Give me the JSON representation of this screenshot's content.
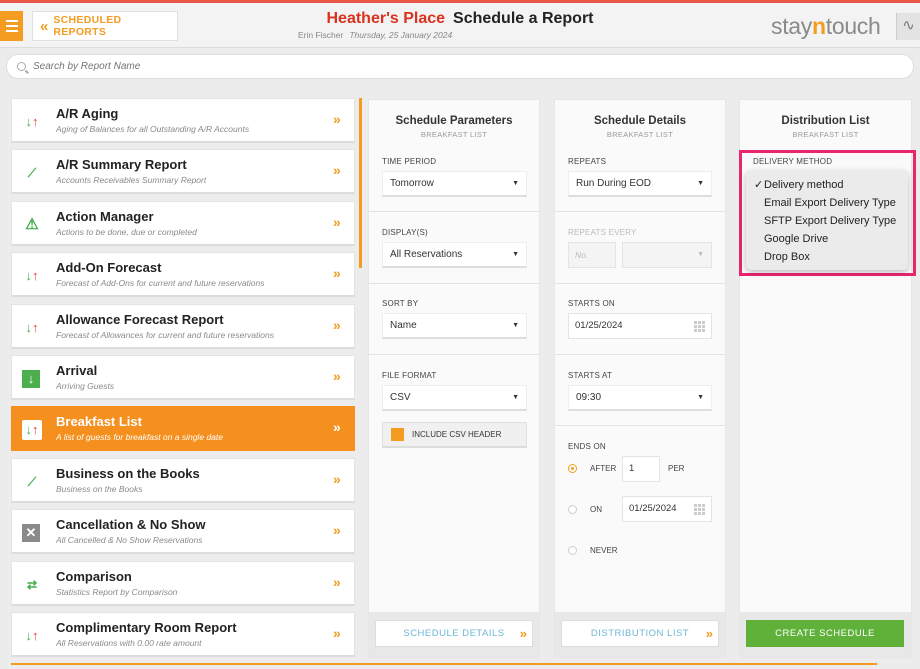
{
  "header": {
    "back_label": "SCHEDULED REPORTS",
    "hotel": "Heather's Place",
    "title": "Schedule a Report",
    "user": "Erin Fischer",
    "date": "Thursday, 25 January 2024",
    "logo_pre": "stay",
    "logo_n": "n",
    "logo_post": "touch"
  },
  "search": {
    "placeholder": "Search by Report Name"
  },
  "reports": [
    {
      "name": "A/R Aging",
      "desc": "Aging of Balances for all Outstanding A/R Accounts",
      "icon": "up-down-arrows-icon"
    },
    {
      "name": "A/R Summary Report",
      "desc": "Accounts Receivables Summary Report",
      "icon": "trend-chart-icon"
    },
    {
      "name": "Action Manager",
      "desc": "Actions to be done, due or completed",
      "icon": "warning-icon"
    },
    {
      "name": "Add-On Forecast",
      "desc": "Forecast of Add-Ons for current and future reservations",
      "icon": "up-down-arrows-icon"
    },
    {
      "name": "Allowance Forecast Report",
      "desc": "Forecast of Allowances for current and future reservations",
      "icon": "up-down-arrows-icon"
    },
    {
      "name": "Arrival",
      "desc": "Arriving Guests",
      "icon": "arrival-icon"
    },
    {
      "name": "Breakfast List",
      "desc": "A list of guests for breakfast on a single date",
      "icon": "up-down-arrows-icon"
    },
    {
      "name": "Business on the Books",
      "desc": "Business on the Books",
      "icon": "trend-chart-icon"
    },
    {
      "name": "Cancellation & No Show",
      "desc": "All Cancelled & No Show Reservations",
      "icon": "cancel-icon"
    },
    {
      "name": "Comparison",
      "desc": "Statistics Report by Comparison",
      "icon": "compare-icon"
    },
    {
      "name": "Complimentary Room Report",
      "desc": "All Reservations with 0.00 rate amount",
      "icon": "up-down-arrows-icon"
    }
  ],
  "selected_report_index": 6,
  "params": {
    "title": "Schedule Parameters",
    "subtitle": "BREAKFAST LIST",
    "time_period_label": "TIME PERIOD",
    "time_period": "Tomorrow",
    "display_label": "DISPLAY(S)",
    "display": "All Reservations",
    "sort_label": "SORT BY",
    "sort": "Name",
    "format_label": "FILE FORMAT",
    "format": "CSV",
    "csv_header_label": "INCLUDE CSV HEADER",
    "next_label": "SCHEDULE DETAILS"
  },
  "details": {
    "title": "Schedule Details",
    "subtitle": "BREAKFAST LIST",
    "repeats_label": "REPEATS",
    "repeats": "Run During EOD",
    "repeats_every_label": "REPEATS EVERY",
    "repeats_every_placeholder": "No.",
    "starts_on_label": "STARTS ON",
    "starts_on": "01/25/2024",
    "starts_at_label": "STARTS AT",
    "starts_at": "09:30",
    "ends_on_label": "ENDS ON",
    "after_label": "AFTER",
    "after_value": "1",
    "per_label": "PER",
    "on_label": "ON",
    "on_value": "01/25/2024",
    "never_label": "NEVER",
    "next_label": "DISTRIBUTION LIST"
  },
  "distribution": {
    "title": "Distribution List",
    "subtitle": "BREAKFAST LIST",
    "delivery_label": "DELIVERY METHOD",
    "options": [
      "Delivery method",
      "Email Export Delivery Type",
      "SFTP Export Delivery Type",
      "Google Drive",
      "Drop Box"
    ],
    "selected_option": "Delivery method",
    "check_mark": "✓",
    "create_label": "CREATE SCHEDULE"
  },
  "colors": {
    "accent": "#f39c1f",
    "hotel": "#d9331f",
    "create": "#5fb13a",
    "highlight": "#e8266e"
  }
}
